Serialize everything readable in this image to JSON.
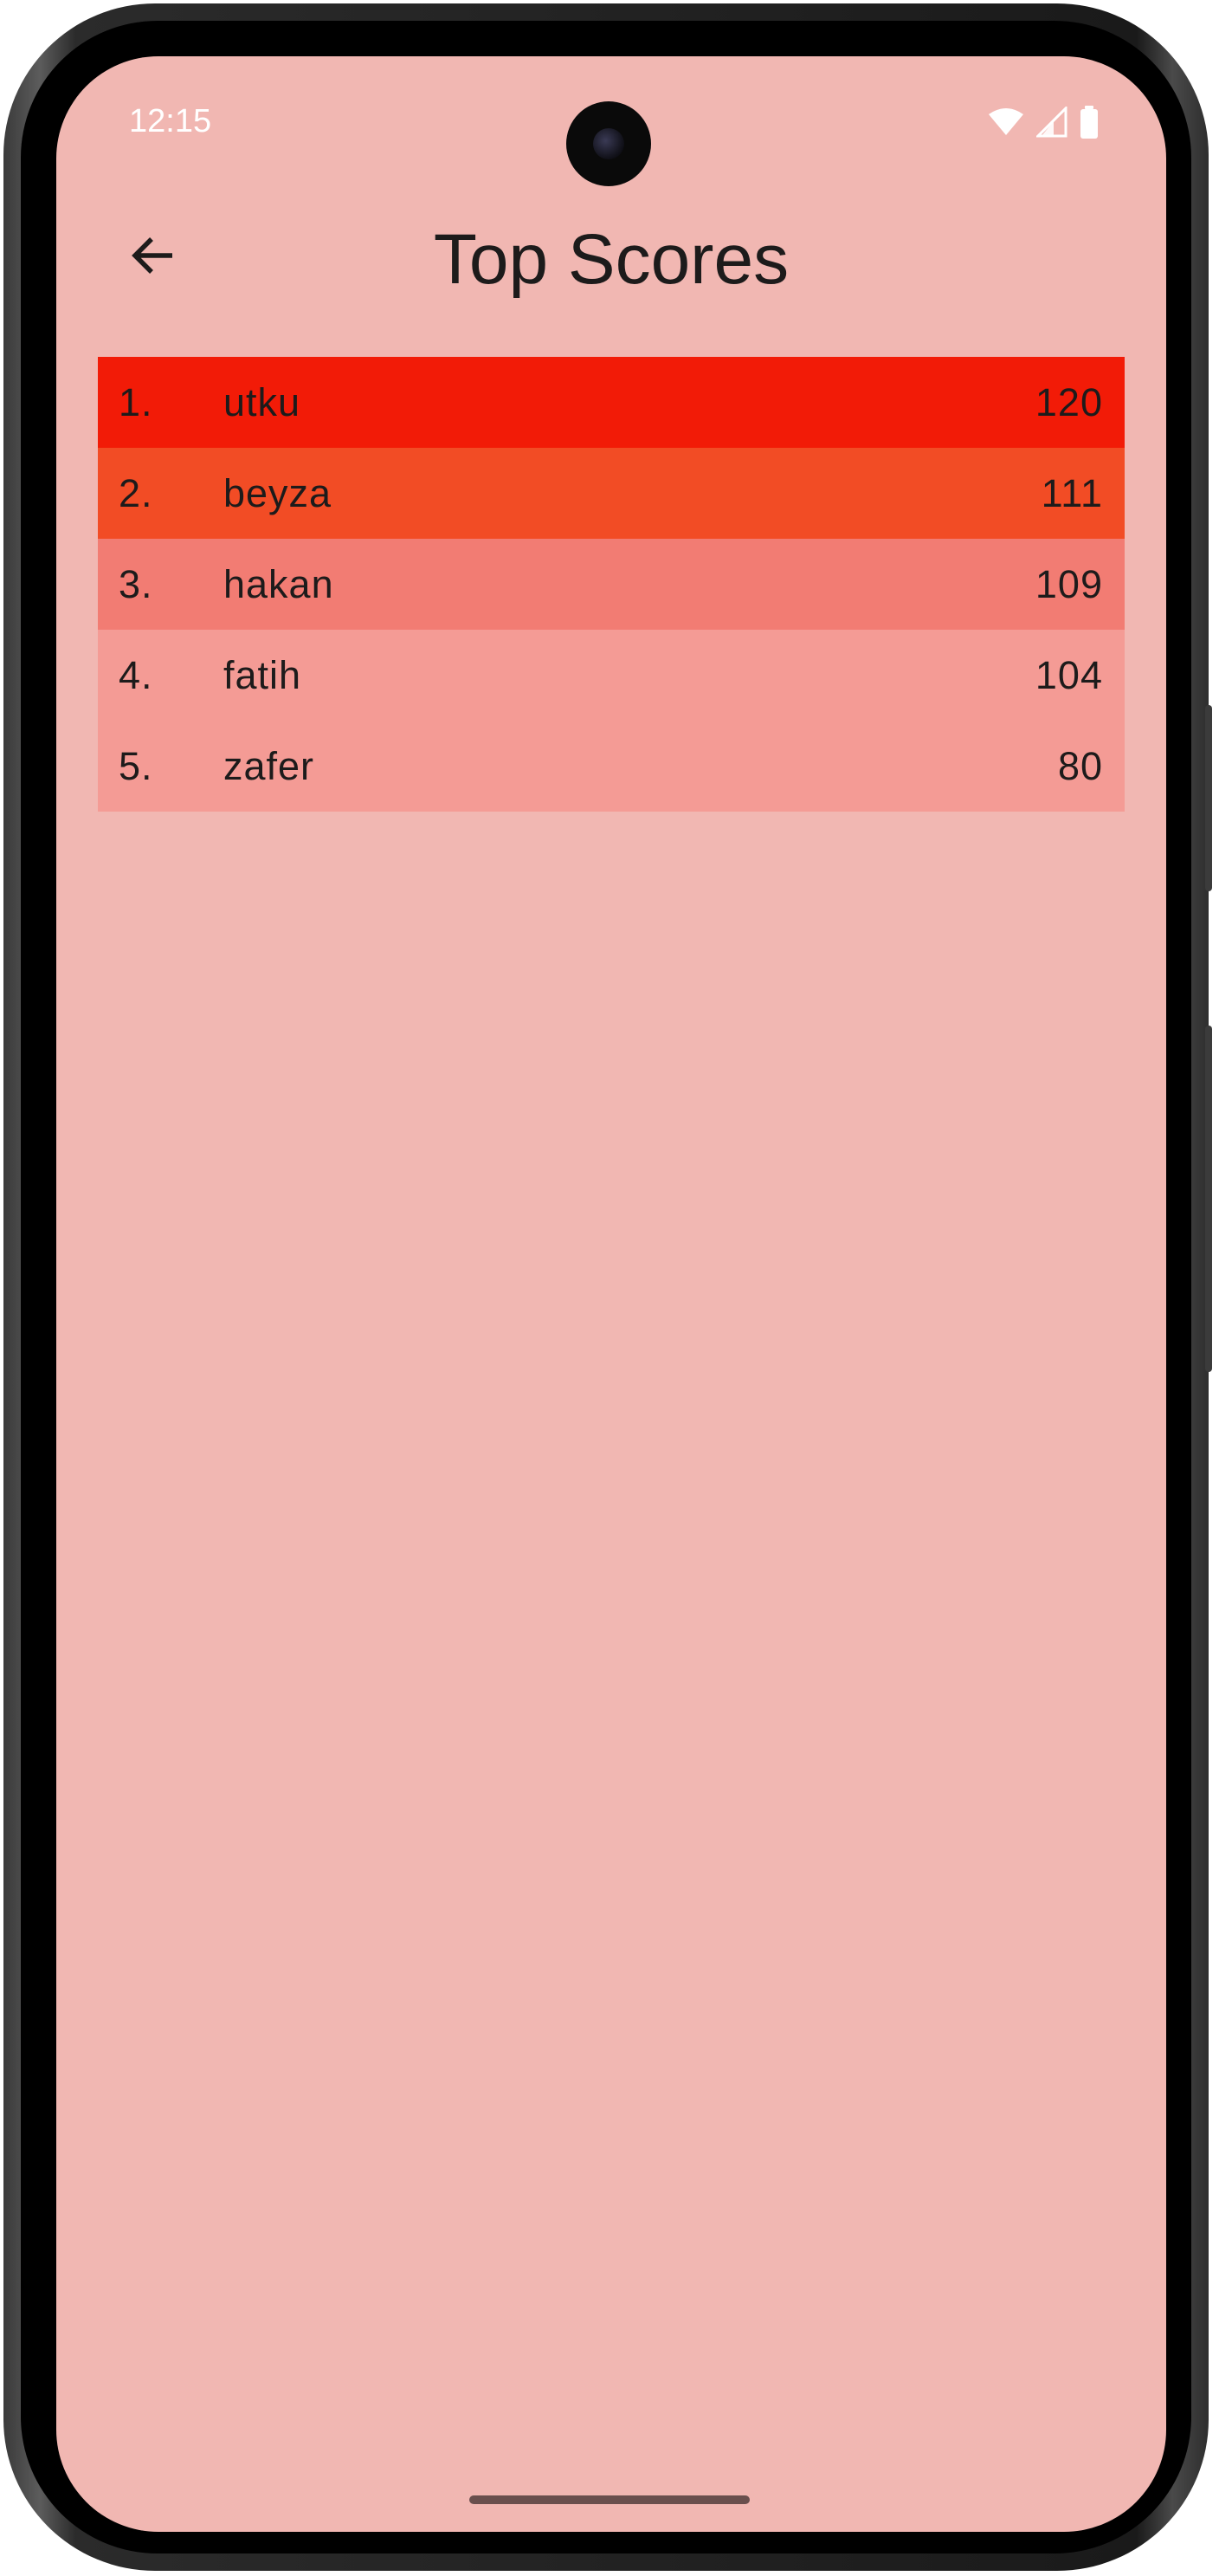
{
  "status_bar": {
    "time": "12:15",
    "icons": [
      "wifi-icon",
      "cellular-signal-icon",
      "battery-icon"
    ]
  },
  "app_bar": {
    "back_icon": "arrow-back-icon",
    "title": "Top Scores"
  },
  "scores": [
    {
      "rank": "1.",
      "name": "utku",
      "score": "120",
      "color": "#f21b07"
    },
    {
      "rank": "2.",
      "name": "beyza",
      "score": "111",
      "color": "#f24c25"
    },
    {
      "rank": "3.",
      "name": "hakan",
      "score": "109",
      "color": "#f27c73"
    },
    {
      "rank": "4.",
      "name": "fatih",
      "score": "104",
      "color": "#f49b95"
    },
    {
      "rank": "5.",
      "name": "zafer",
      "score": "80",
      "color": "#f49b95"
    }
  ],
  "colors": {
    "screen_background": "#f1b7b2",
    "title_text": "#1d1b1b",
    "home_indicator": "#6a4f4d"
  }
}
